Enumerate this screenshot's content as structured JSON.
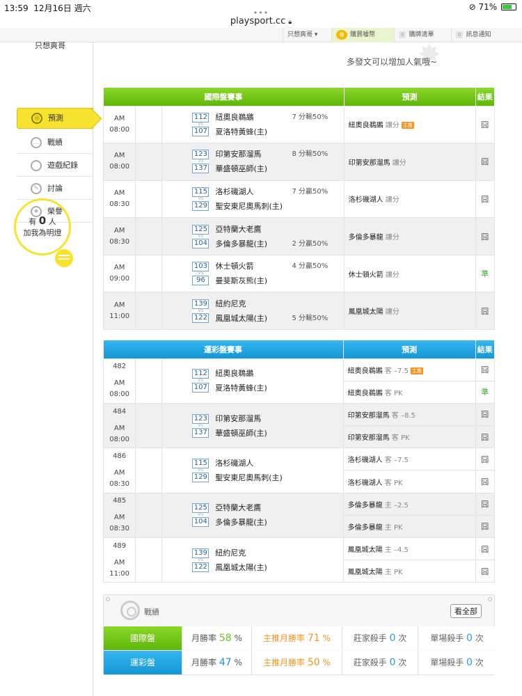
{
  "status": {
    "time": "13:59",
    "date": "12月16日 週六",
    "battery": "71%"
  },
  "browser": {
    "url": "playsport.cc"
  },
  "topnav": {
    "user_menu": "只想爽哥",
    "buy": "購買噱幣",
    "buy_badge": "噱",
    "buy_list": "購牌清單",
    "buy_list_count": "0",
    "notify": "訊息通知",
    "notify_count": "0"
  },
  "sidebar": {
    "username": "只想爽哥",
    "items": [
      {
        "label": "預測",
        "icon": "target-icon"
      },
      {
        "label": "戰績",
        "icon": "chat-icon"
      },
      {
        "label": "遊戲紀錄",
        "icon": "circle-icon"
      },
      {
        "label": "討論",
        "icon": "pen-icon"
      },
      {
        "label": "榮譽",
        "icon": "medal-icon"
      }
    ],
    "bulb": {
      "prefix": "有",
      "count": "0",
      "suffix": "人",
      "line2": "加我為明燈"
    }
  },
  "promo": "多發文可以增加人氣哦~",
  "intl": {
    "headers": [
      "國際盤賽事",
      "預測",
      "結果"
    ],
    "rows": [
      {
        "time": "AM 08:00",
        "code1": "112",
        "code2": "107",
        "team1": "紐奧良鵜鶘",
        "team2": "夏洛特黃蜂(主)",
        "spread": "7 分輸50%",
        "spread_row": 1,
        "pick": "紐奧良鵜鶘",
        "pick_sub": "讓分",
        "tag": "主推",
        "result": "囧"
      },
      {
        "time": "AM 08:00",
        "code1": "123",
        "code2": "137",
        "team1": "印第安那溜馬",
        "team2": "華盛頓巫師(主)",
        "spread": "8 分輸50%",
        "spread_row": 1,
        "pick": "印第安那溜馬",
        "pick_sub": "讓分",
        "tag": "",
        "result": "囧"
      },
      {
        "time": "AM 08:30",
        "code1": "115",
        "code2": "129",
        "team1": "洛杉磯湖人",
        "team2": "聖安東尼奧馬刺(主)",
        "spread": "7 分贏50%",
        "spread_row": 1,
        "pick": "洛杉磯湖人",
        "pick_sub": "讓分",
        "tag": "",
        "result": "囧"
      },
      {
        "time": "AM 08:30",
        "code1": "125",
        "code2": "104",
        "team1": "亞特蘭大老鷹",
        "team2": "多倫多暴龍(主)",
        "spread": "2 分贏50%",
        "spread_row": 2,
        "pick": "多倫多暴龍",
        "pick_sub": "讓分",
        "tag": "",
        "result": "囧"
      },
      {
        "time": "AM 09:00",
        "code1": "103",
        "code2": "96",
        "team1": "休士頓火箭",
        "team2": "曼斐斯灰熊(主)",
        "spread": "4 分贏50%",
        "spread_row": 1,
        "pick": "休士頓火箭",
        "pick_sub": "讓分",
        "tag": "",
        "result": "準"
      },
      {
        "time": "AM 11:00",
        "code1": "139",
        "code2": "122",
        "team1": "紐約尼克",
        "team2": "鳳凰城太陽(主)",
        "spread": "5 分輸50%",
        "spread_row": 2,
        "pick": "鳳凰城太陽",
        "pick_sub": "讓分",
        "tag": "",
        "result": "囧"
      }
    ]
  },
  "lottery": {
    "headers": [
      "運彩盤賽事",
      "預測",
      "結果"
    ],
    "rows": [
      {
        "no": "482",
        "time": "AM 08:00",
        "code1": "112",
        "code2": "107",
        "team1": "紐奧良鵜鶘",
        "team2": "夏洛特黃蜂(主)",
        "picks": [
          {
            "team": "紐奧良鵜鶘",
            "sub": "客 –7.5",
            "tag": "主推",
            "result": "囧"
          },
          {
            "team": "紐奧良鵜鶘",
            "sub": "客 PK",
            "tag": "",
            "result": "準"
          }
        ]
      },
      {
        "no": "484",
        "time": "AM 08:00",
        "code1": "123",
        "code2": "137",
        "team1": "印第安那溜馬",
        "team2": "華盛頓巫師(主)",
        "picks": [
          {
            "team": "印第安那溜馬",
            "sub": "客 –8.5",
            "tag": "",
            "result": "囧"
          },
          {
            "team": "印第安那溜馬",
            "sub": "客 PK",
            "tag": "",
            "result": "囧"
          }
        ]
      },
      {
        "no": "486",
        "time": "AM 08:30",
        "code1": "115",
        "code2": "129",
        "team1": "洛杉磯湖人",
        "team2": "聖安東尼奧馬刺(主)",
        "picks": [
          {
            "team": "洛杉磯湖人",
            "sub": "客 –7.5",
            "tag": "",
            "result": "囧"
          },
          {
            "team": "洛杉磯湖人",
            "sub": "客 PK",
            "tag": "",
            "result": "囧"
          }
        ]
      },
      {
        "no": "485",
        "time": "AM 08:30",
        "code1": "125",
        "code2": "104",
        "team1": "亞特蘭大老鷹",
        "team2": "多倫多暴龍(主)",
        "picks": [
          {
            "team": "多倫多暴龍",
            "sub": "主 –2.5",
            "tag": "",
            "result": "囧"
          },
          {
            "team": "多倫多暴龍",
            "sub": "主 PK",
            "tag": "",
            "result": "囧"
          }
        ]
      },
      {
        "no": "489",
        "time": "AM 11:00",
        "code1": "139",
        "code2": "122",
        "team1": "紐約尼克",
        "team2": "鳳凰城太陽(主)",
        "picks": [
          {
            "team": "鳳凰城太陽",
            "sub": "主 –4.5",
            "tag": "",
            "result": "囧"
          },
          {
            "team": "鳳凰城太陽",
            "sub": "主 PK",
            "tag": "",
            "result": "囧"
          }
        ]
      }
    ]
  },
  "record": {
    "title": "戰績",
    "view_all": "看全部",
    "rows": [
      {
        "label": "國際盤",
        "monthly_label": "月勝率",
        "monthly": "58",
        "top_label": "主推月勝率",
        "top": "71",
        "pct": "%",
        "dealer_label": "莊家殺手",
        "dealer": "0",
        "single_label": "單場殺手",
        "single": "0",
        "unit": "次"
      },
      {
        "label": "運彩盤",
        "monthly_label": "月勝率",
        "monthly": "47",
        "top_label": "主推月勝率",
        "top": "50",
        "pct": "%",
        "dealer_label": "莊家殺手",
        "dealer": "0",
        "single_label": "單場殺手",
        "single": "0",
        "unit": "次"
      }
    ]
  },
  "colors": {
    "green": "#5fb50a",
    "blue": "#1597d6",
    "yellow": "#f7e22d",
    "orange": "#f7931e",
    "win": "#3aa935"
  }
}
